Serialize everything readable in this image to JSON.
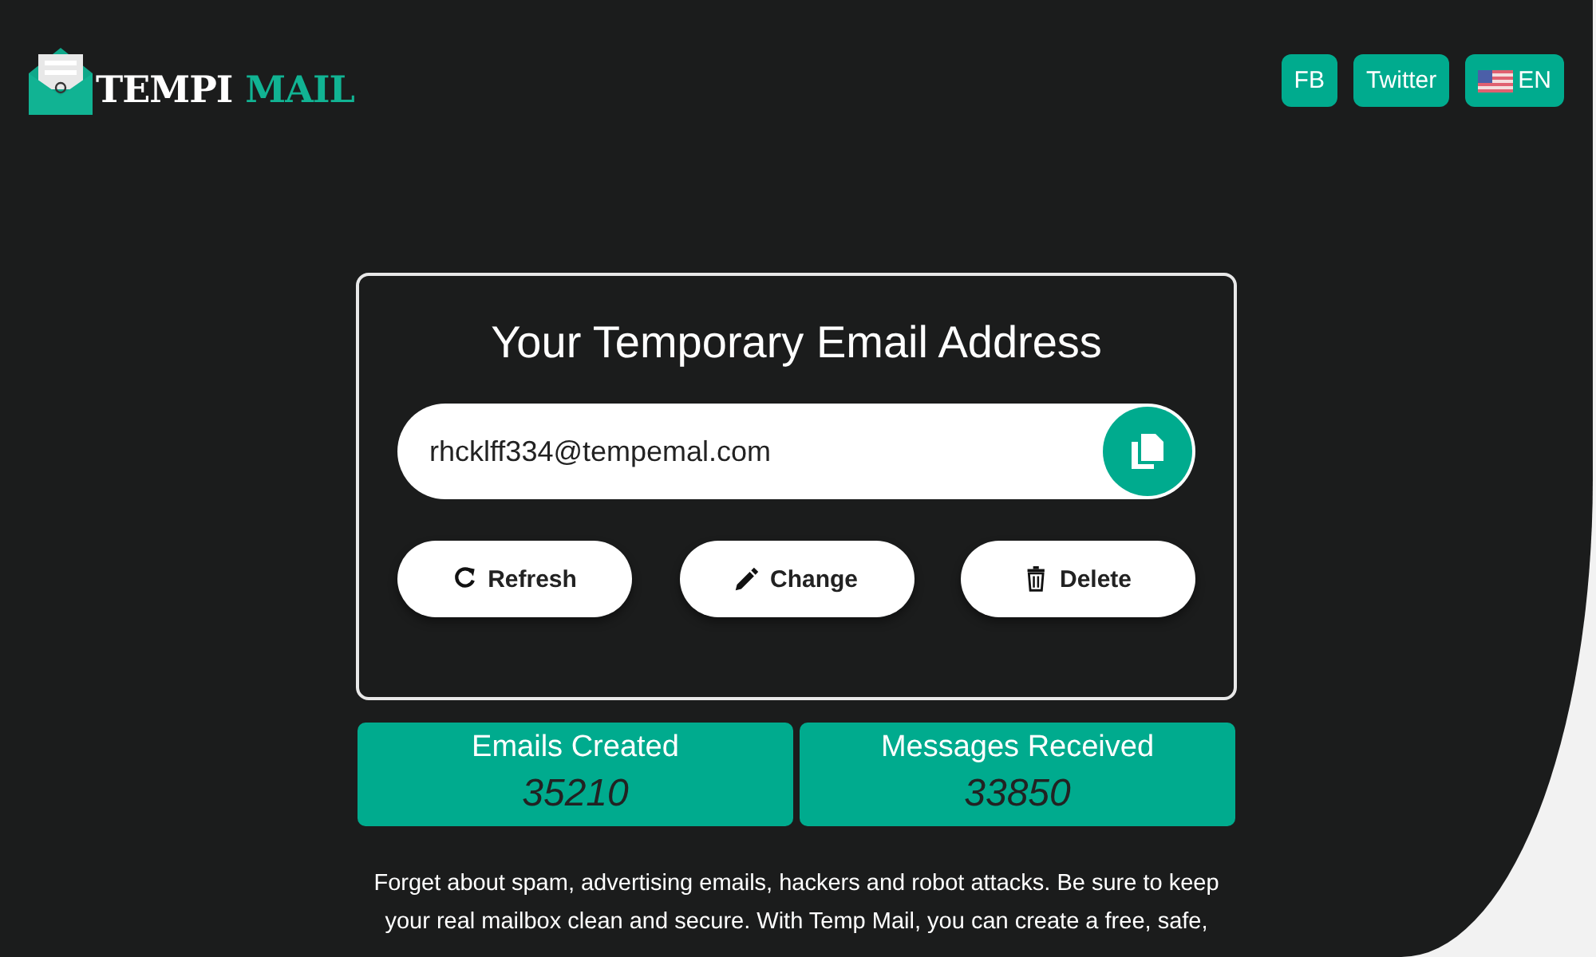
{
  "logo": {
    "word_1": "TEMPI",
    "word_2": "MAIL"
  },
  "header_links": [
    {
      "label": "FB",
      "kind": "text"
    },
    {
      "label": "Twitter",
      "kind": "text"
    },
    {
      "label": "EN",
      "kind": "flag"
    }
  ],
  "card": {
    "title": "Your Temporary Email Address",
    "email": "rhcklff334@tempemal.com",
    "actions": [
      {
        "label": "Refresh",
        "kind": "refresh"
      },
      {
        "label": "Change",
        "kind": "edit"
      },
      {
        "label": "Delete",
        "kind": "delete"
      }
    ]
  },
  "stats": [
    {
      "label": "Emails Created",
      "value": "35210"
    },
    {
      "label": "Messages Received",
      "value": "33850"
    }
  ],
  "intro": "Forget about spam, advertising emails, hackers and robot attacks. Be sure to keep your real mailbox clean and secure. With Temp Mail, you can create a free, safe,"
}
